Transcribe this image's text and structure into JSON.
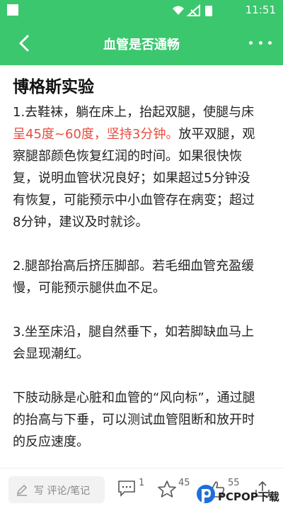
{
  "status": {
    "time": "11:51"
  },
  "toolbar": {
    "title": "血管是否通畅"
  },
  "article": {
    "heading": "博格斯实验",
    "p1_line1": "1.去鞋袜，躺在床上，抬起双腿，使腿与床",
    "p1_red": "呈45度~60度，坚持3分钟。",
    "p1_rest_line2": "放平双腿，观",
    "p1_line3": "察腿部颜色恢复红润的时间。如果很快恢",
    "p1_line4": "复，说明血管状况良好；如果超过5分钟没",
    "p1_line5": "有恢复，可能预示中小血管存在病变；超过",
    "p1_line6": "8分钟，建议及时就诊。",
    "p2_line1": "2.腿部抬高后挤压脚部。若毛细血管充盈缓",
    "p2_line2": "慢，可能预示腿供血不足。",
    "p3_line1": "3.坐至床沿，腿自然垂下，如若脚缺血马上",
    "p3_line2": "会显现潮红。",
    "p4_line1": "下肢动脉是心脏和血管的“风向标”，通过腿",
    "p4_line2": "的抬高与下垂，可以测试血管阻断和放开时",
    "p4_line3": "的反应速度。"
  },
  "bottom": {
    "comment_placeholder": "写 评论/笔记",
    "comment_count": "1",
    "star_count": "45",
    "like_count": "55"
  },
  "watermark": {
    "text": "PCPOP下载"
  },
  "colors": {
    "primary": "#3bc76e",
    "highlight": "#e84c3d"
  }
}
